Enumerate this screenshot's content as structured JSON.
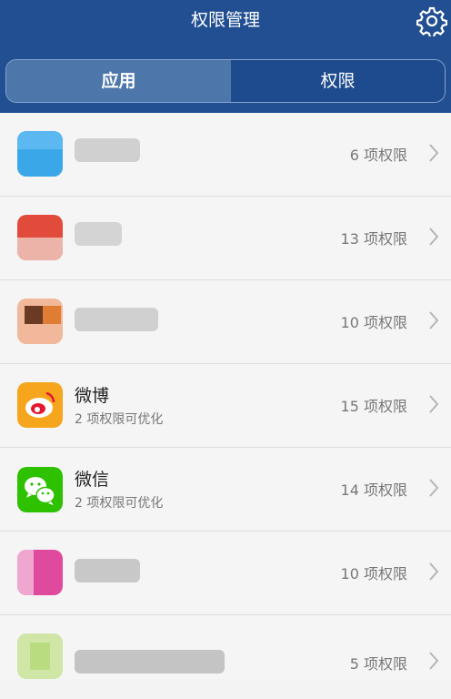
{
  "header": {
    "title": "权限管理",
    "settings_icon": "gear-icon"
  },
  "tabs": [
    {
      "label": "应用",
      "selected": true
    },
    {
      "label": "权限",
      "selected": false
    }
  ],
  "apps": [
    {
      "name": "",
      "sub": "",
      "count": "6 项权限"
    },
    {
      "name": "",
      "sub": "",
      "count": "13 项权限"
    },
    {
      "name": "",
      "sub": "",
      "count": "10 项权限"
    },
    {
      "name": "微博",
      "sub": "2 项权限可优化",
      "count": "15 项权限"
    },
    {
      "name": "微信",
      "sub": "2 项权限可优化",
      "count": "14 项权限"
    },
    {
      "name": "",
      "sub": "",
      "count": "10 项权限"
    },
    {
      "name": "",
      "sub": "",
      "count": "5 项权限"
    }
  ],
  "colors": {
    "header": "#214f91",
    "tab_active": "#4d76ab",
    "weibo": "#f6a61c",
    "wechat": "#2dc100"
  }
}
